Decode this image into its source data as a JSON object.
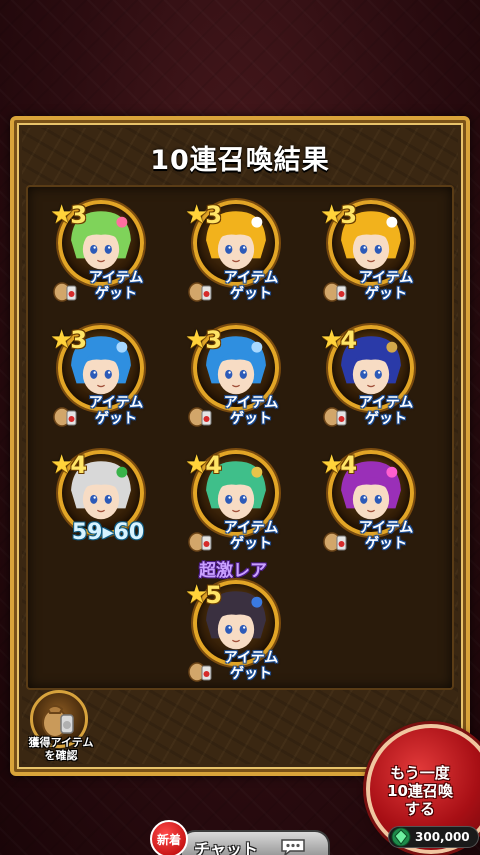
{
  "title": "10連召喚結果",
  "units": [
    {
      "stars": "3",
      "caption": "アイテム\nゲット",
      "char": "green-haired-elf",
      "hair": "#7fd35a",
      "accent": "#ff6fa0"
    },
    {
      "stars": "3",
      "caption": "アイテム\nゲット",
      "char": "white-fox",
      "hair": "#f2b21c",
      "accent": "#ffffff"
    },
    {
      "stars": "3",
      "caption": "アイテム\nゲット",
      "char": "white-fox",
      "hair": "#f2b21c",
      "accent": "#ffffff"
    },
    {
      "stars": "3",
      "caption": "アイテム\nゲット",
      "char": "blue-haired-elf",
      "hair": "#2f8fe0",
      "accent": "#a8d8ff"
    },
    {
      "stars": "3",
      "caption": "アイテム\nゲット",
      "char": "blue-haired-elf",
      "hair": "#2f8fe0",
      "accent": "#a8d8ff"
    },
    {
      "stars": "4",
      "caption": "アイテム\nゲット",
      "char": "navy-haired-warrior",
      "hair": "#2a3aa8",
      "accent": "#d4a84a"
    },
    {
      "stars": "4",
      "caption": "59▸60",
      "char": "silver-haired-snake",
      "hair": "#d8d8d8",
      "accent": "#39b34a",
      "level": true
    },
    {
      "stars": "4",
      "caption": "アイテム\nゲット",
      "char": "green-haired-mage",
      "hair": "#3fbf8a",
      "accent": "#e8c44a"
    },
    {
      "stars": "4",
      "caption": "アイテム\nゲット",
      "char": "purple-haired-demon",
      "hair": "#9a2fb8",
      "accent": "#ff5fd0"
    },
    {
      "stars": "5",
      "caption": "アイテム\nゲット",
      "char": "dark-haired-girl",
      "hair": "#3a3040",
      "accent": "#3a7ae0",
      "rarity": "超激レア"
    }
  ],
  "confirm_button": {
    "label": "獲得アイテム\nを確認"
  },
  "again_button": {
    "label": "もう一度\n10連召喚\nする"
  },
  "cost": {
    "value": "300,000",
    "icon": "green-gem-icon"
  },
  "chat": {
    "label": "チャット",
    "badge": "新着",
    "icon": "speech-bubble-icon"
  },
  "colors": {
    "gold": "#e2a526",
    "panel": "#3a2712",
    "again": "#a80f15"
  }
}
